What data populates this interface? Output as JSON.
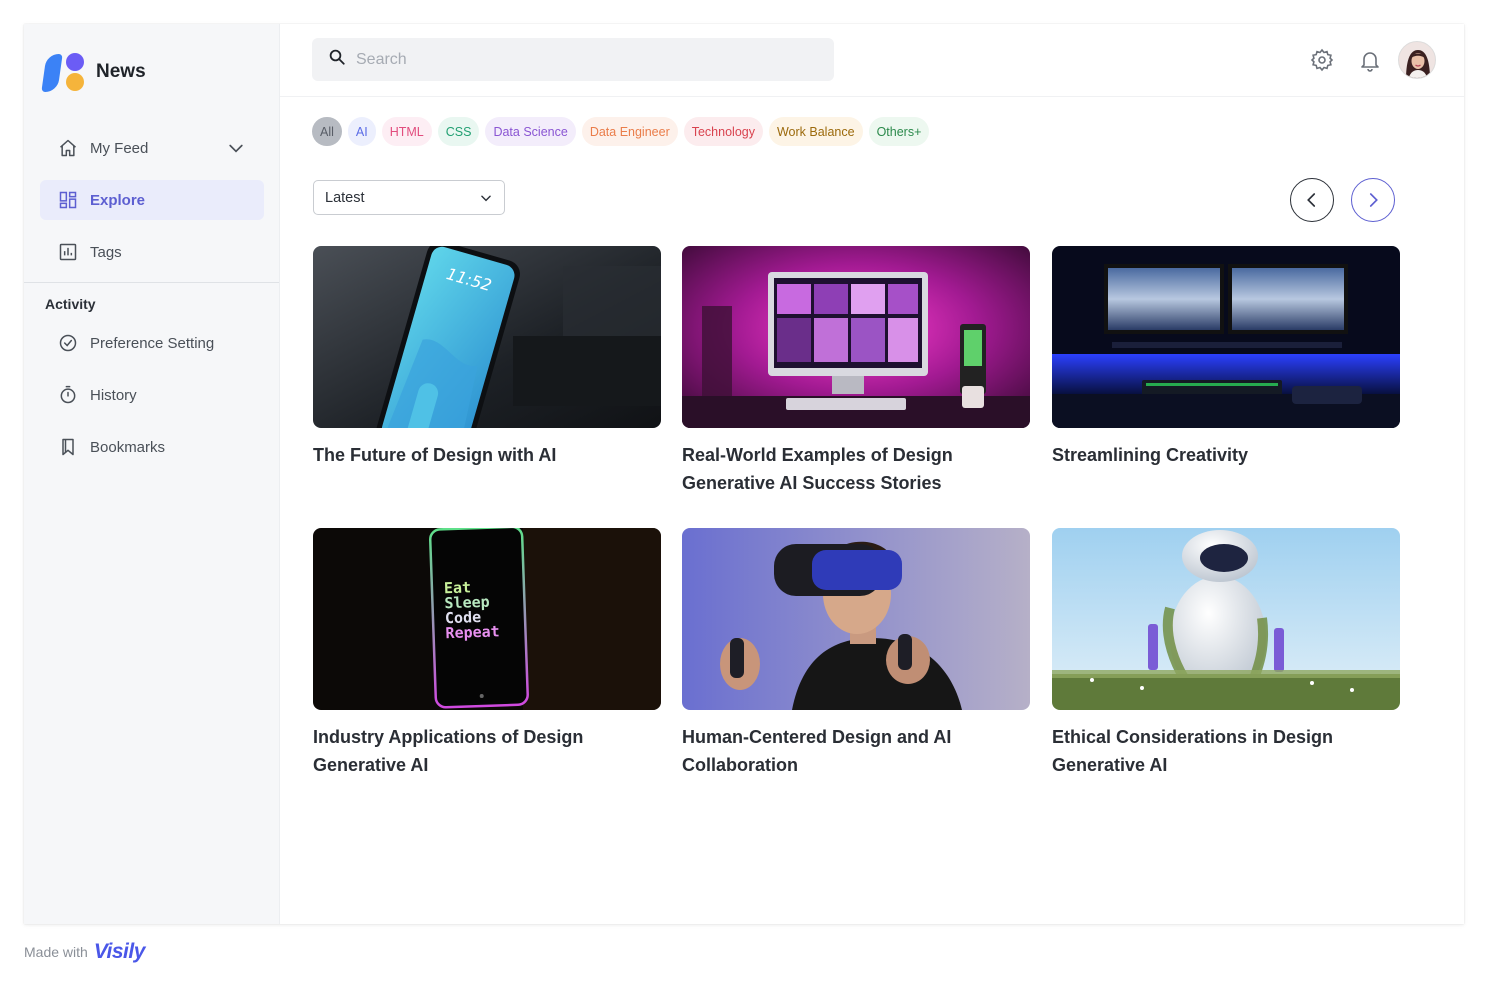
{
  "app": {
    "name": "News"
  },
  "sidebar": {
    "items": [
      {
        "label": "My Feed"
      },
      {
        "label": "Explore"
      },
      {
        "label": "Tags"
      }
    ],
    "activity_title": "Activity",
    "activity_items": [
      {
        "label": "Preference Setting"
      },
      {
        "label": "History"
      },
      {
        "label": "Bookmarks"
      }
    ]
  },
  "search": {
    "placeholder": "Search",
    "value": ""
  },
  "tags": [
    {
      "label": "All",
      "color": "#585d66",
      "bg": "#b7bbc2"
    },
    {
      "label": "AI",
      "color": "#5b6ce6",
      "bg": "#eceffd"
    },
    {
      "label": "HTML",
      "color": "#e24d7e",
      "bg": "#fdeef4"
    },
    {
      "label": "CSS",
      "color": "#22a072",
      "bg": "#e9f7f1"
    },
    {
      "label": "Data Science",
      "color": "#8a55d3",
      "bg": "#f3edfb"
    },
    {
      "label": "Data Engineer",
      "color": "#ea7d4a",
      "bg": "#fdf1eb"
    },
    {
      "label": "Technology",
      "color": "#d9434f",
      "bg": "#fcecee"
    },
    {
      "label": "Work Balance",
      "color": "#9c6a0c",
      "bg": "#fdf4e6"
    },
    {
      "label": "Others+",
      "color": "#2c8a4c",
      "bg": "#edf8f0"
    }
  ],
  "sort": {
    "selected": "Latest"
  },
  "cards": [
    {
      "title": "The Future of Design with AI",
      "image": "phone-on-desk"
    },
    {
      "title": "Real-World Examples of Design Generative AI Success Stories",
      "image": "pink-desk-setup"
    },
    {
      "title": "Streamlining Creativity",
      "image": "blue-monitors-setup"
    },
    {
      "title": "Industry Applications of Design Generative AI",
      "image": "neon-phone-eat-sleep-code",
      "phone_text": [
        "Eat",
        "Sleep",
        "Code",
        "Repeat"
      ]
    },
    {
      "title": "Human-Centered Design and AI Collaboration",
      "image": "man-vr-headset"
    },
    {
      "title": "Ethical Considerations in Design Generative AI",
      "image": "robot-in-grass"
    }
  ],
  "phone_clock": "11:52",
  "footer": {
    "made_with": "Made with",
    "brand": "Visily"
  },
  "colors": {
    "accent": "#5d5fd1",
    "sidebar_bg": "#f6f7f9"
  }
}
